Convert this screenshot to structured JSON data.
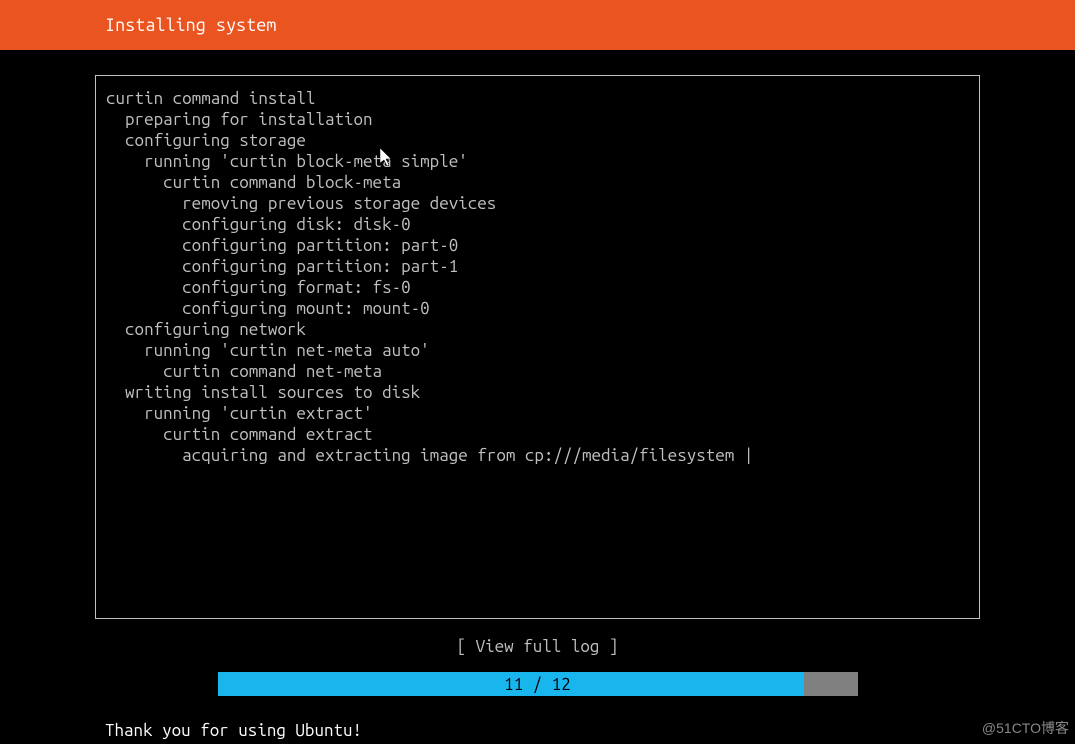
{
  "header": {
    "title": "Installing system"
  },
  "log": {
    "lines": [
      {
        "text": "curtin command install",
        "indent": 0
      },
      {
        "text": "preparing for installation",
        "indent": 1
      },
      {
        "text": "configuring storage",
        "indent": 1
      },
      {
        "text": "running 'curtin block-meta simple'",
        "indent": 2
      },
      {
        "text": "curtin command block-meta",
        "indent": 3
      },
      {
        "text": "removing previous storage devices",
        "indent": 4
      },
      {
        "text": "configuring disk: disk-0",
        "indent": 4
      },
      {
        "text": "configuring partition: part-0",
        "indent": 4
      },
      {
        "text": "configuring partition: part-1",
        "indent": 4
      },
      {
        "text": "configuring format: fs-0",
        "indent": 4
      },
      {
        "text": "configuring mount: mount-0",
        "indent": 4
      },
      {
        "text": "configuring network",
        "indent": 1
      },
      {
        "text": "running 'curtin net-meta auto'",
        "indent": 2
      },
      {
        "text": "curtin command net-meta",
        "indent": 3
      },
      {
        "text": "writing install sources to disk",
        "indent": 1
      },
      {
        "text": "running 'curtin extract'",
        "indent": 2
      },
      {
        "text": "curtin command extract",
        "indent": 3
      },
      {
        "text": "acquiring and extracting image from cp:///media/filesystem |",
        "indent": 4
      }
    ]
  },
  "actions": {
    "view_log_label": "[ View full log ]"
  },
  "progress": {
    "label": "11 / 12",
    "current": 11,
    "total": 12
  },
  "footer": {
    "message": "Thank you for using Ubuntu!"
  },
  "watermark": "@51CTO博客"
}
